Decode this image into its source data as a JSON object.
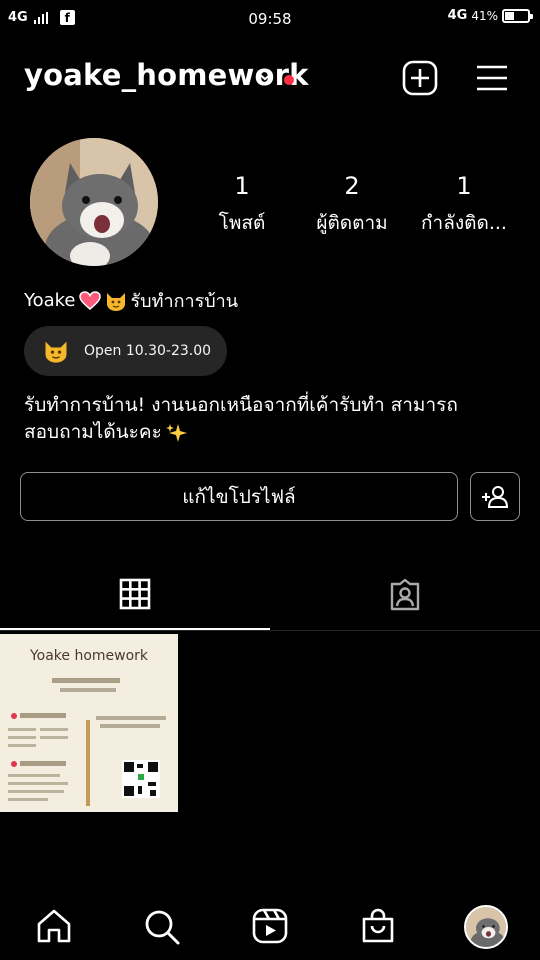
{
  "status_bar": {
    "network_left": "4G",
    "time": "09:58",
    "network_right": "4G",
    "battery_text": "41%",
    "battery_level": 0.41
  },
  "header": {
    "username": "yoake_homework"
  },
  "profile": {
    "stats": [
      {
        "count": "1",
        "label": "โพสต์"
      },
      {
        "count": "2",
        "label": "ผู้ติดตาม"
      },
      {
        "count": "1",
        "label": "กำลังติด..."
      }
    ],
    "display_name": "Yoake",
    "name_suffix": "รับทำการบ้าน",
    "hours_text": "Open 10.30-23.00",
    "bio_line1": "รับทำการบ้าน! งานนอกเหนือจากที่เค้ารับทำ สามารถ",
    "bio_line2": "สอบถามได้นะคะ",
    "edit_profile_label": "แก้ไขโปรไฟล์"
  },
  "post": {
    "thumb_title": "Yoake homework"
  },
  "icons": {
    "new_post": "plus-square-icon",
    "menu": "hamburger-menu-icon",
    "grid_tab": "grid-icon",
    "tagged_tab": "tagged-person-icon",
    "nav": [
      "home-icon",
      "search-icon",
      "reels-icon",
      "shop-icon",
      "profile-avatar"
    ]
  },
  "colors": {
    "background": "#000000",
    "notification_dot": "#ff3040",
    "pill_bg": "#262626",
    "button_border": "#8e8e8e"
  }
}
